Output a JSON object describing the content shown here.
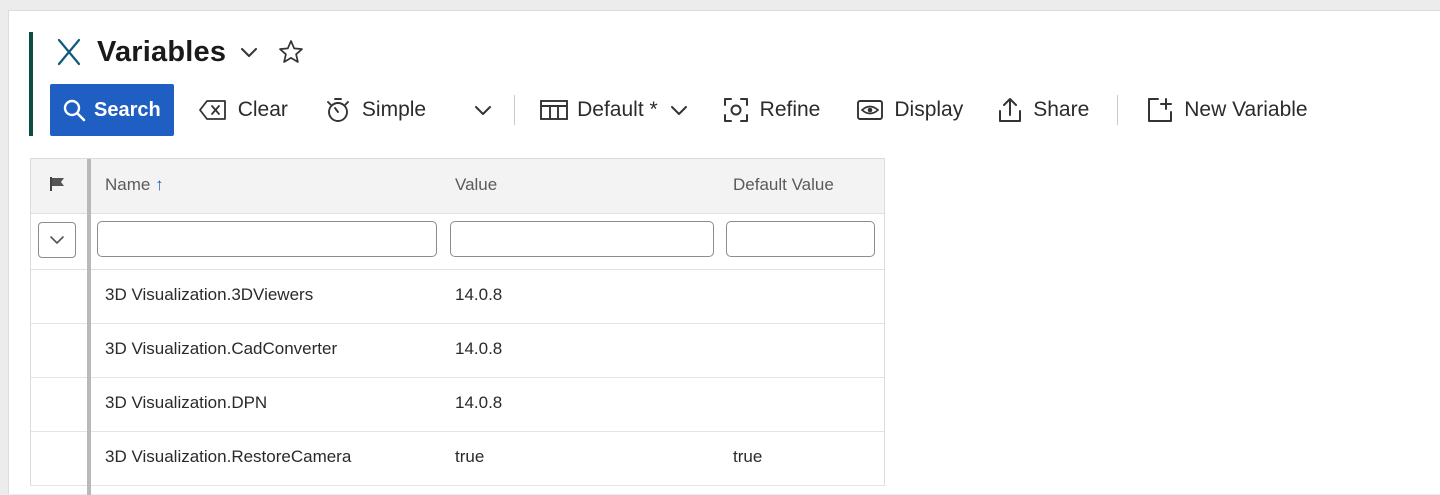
{
  "header": {
    "title": "Variables"
  },
  "toolbar": {
    "search_label": "Search",
    "clear_label": "Clear",
    "simple_label": "Simple",
    "view_label": "Default *",
    "refine_label": "Refine",
    "display_label": "Display",
    "share_label": "Share",
    "new_label": "New Variable"
  },
  "grid": {
    "columns": [
      "Name",
      "Value",
      "Default Value"
    ],
    "sort_indicator": "↑",
    "filters": {
      "name": "",
      "value": "",
      "default_value": ""
    },
    "rows": [
      {
        "name": "3D Visualization.3DViewers",
        "value": "14.0.8",
        "default_value": ""
      },
      {
        "name": "3D Visualization.CadConverter",
        "value": "14.0.8",
        "default_value": ""
      },
      {
        "name": "3D Visualization.DPN",
        "value": "14.0.8",
        "default_value": ""
      },
      {
        "name": "3D Visualization.RestoreCamera",
        "value": "true",
        "default_value": "true"
      }
    ]
  },
  "colors": {
    "accent": "#0b4d43",
    "primary_button": "#1f5fc4",
    "sort_arrow": "#1f5fc4",
    "app_icon": "#0d5a7a"
  },
  "icons": {
    "app": "x-icon",
    "title_dropdown": "chevron-down-icon",
    "favorite": "star-icon",
    "search": "search-icon",
    "clear": "backspace-icon",
    "simple": "timer-icon",
    "view": "table-columns-icon",
    "refine": "focus-icon",
    "display": "eye-icon",
    "share": "share-icon",
    "new": "add-icon",
    "flag": "flag-icon",
    "filter_toggle": "chevron-down-icon"
  }
}
